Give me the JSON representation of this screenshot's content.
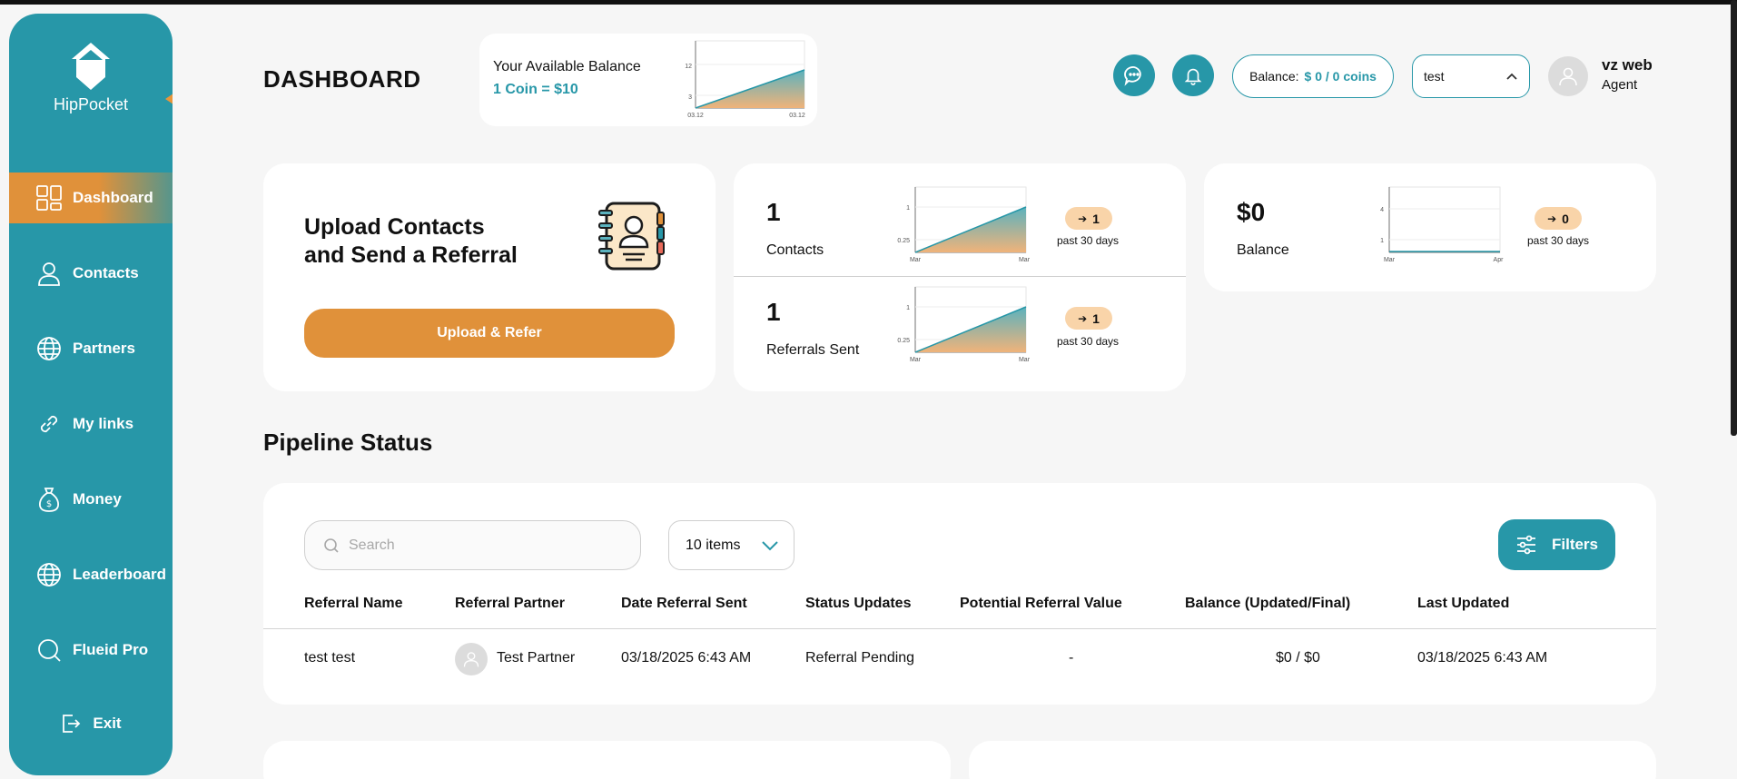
{
  "app": {
    "name": "HipPocket"
  },
  "sidebar": {
    "items": [
      {
        "label": "Dashboard",
        "icon": "dashboard-icon",
        "active": true
      },
      {
        "label": "Contacts",
        "icon": "user-icon"
      },
      {
        "label": "Partners",
        "icon": "globe-icon"
      },
      {
        "label": "My links",
        "icon": "link-icon"
      },
      {
        "label": "Money",
        "icon": "money-bag-icon"
      },
      {
        "label": "Leaderboard",
        "icon": "globe-icon"
      },
      {
        "label": "Flueid Pro",
        "icon": "search-icon"
      }
    ],
    "exit_label": "Exit"
  },
  "header": {
    "title": "DASHBOARD",
    "balance_card": {
      "title": "Your Available Balance",
      "rate": "1 Coin = $10",
      "chart": {
        "y_ticks": [
          "12",
          "3"
        ],
        "x_ticks": [
          "03.12",
          "03.12"
        ]
      }
    },
    "balance_pill": {
      "label": "Balance:",
      "value": "$ 0 / 0 coins"
    },
    "select": {
      "value": "test"
    },
    "user": {
      "name": "vz web",
      "role": "Agent"
    }
  },
  "cards": {
    "upload": {
      "title_line1": "Upload Contacts",
      "title_line2": "and Send a Referral",
      "button": "Upload & Refer"
    },
    "contacts": {
      "value": "1",
      "label": "Contacts",
      "trend": "1",
      "period": "past 30 days",
      "chart": {
        "y_ticks": [
          "1",
          "0.25"
        ],
        "x_ticks": [
          "Mar",
          "Mar"
        ]
      }
    },
    "referrals": {
      "value": "1",
      "label": "Referrals Sent",
      "trend": "1",
      "period": "past 30 days",
      "chart": {
        "y_ticks": [
          "1",
          "0.25"
        ],
        "x_ticks": [
          "Mar",
          "Mar"
        ]
      }
    },
    "balance": {
      "value": "$0",
      "label": "Balance",
      "trend": "0",
      "period": "past 30 days",
      "chart": {
        "y_ticks": [
          "4",
          "1"
        ],
        "x_ticks": [
          "Mar",
          "Apr"
        ]
      }
    }
  },
  "pipeline": {
    "title": "Pipeline Status",
    "search_placeholder": "Search",
    "items_select": "10 items",
    "filters_label": "Filters",
    "columns": [
      "Referral Name",
      "Referral Partner",
      "Date Referral Sent",
      "Status Updates",
      "Potential Referral Value",
      "Balance (Updated/Final)",
      "Last Updated"
    ],
    "rows": [
      {
        "name": "test test",
        "partner": "Test Partner",
        "date_sent": "03/18/2025 6:43 AM",
        "status": "Referral Pending",
        "value": "-",
        "balance": "$0 / $0",
        "updated": "03/18/2025 6:43 AM"
      }
    ]
  },
  "colors": {
    "accent": "#2797a8",
    "orange": "#e0913a",
    "badge": "#f9d4a9"
  }
}
